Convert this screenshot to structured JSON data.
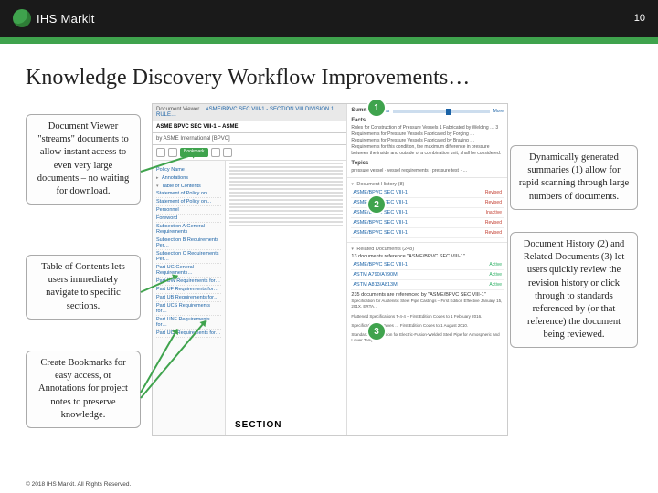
{
  "header": {
    "brand": "IHS Markit",
    "page_number": "10"
  },
  "title": "Knowledge Discovery Workflow Improvements…",
  "callouts": {
    "left1": "Document Viewer \"streams\" documents to allow instant access to even very large documents – no waiting for download.",
    "left2": "Table of Contents lets users immediately navigate to specific sections.",
    "left3": "Create Bookmarks for easy access, or Annotations for project notes to preserve knowledge.",
    "right1": "Dynamically generated summaries (1) allow for rapid scanning through large numbers of documents.",
    "right2": "Document History (2) and Related Documents (3) let users quickly review the revision history or click through to standards referenced by (or that reference) the document being reviewed."
  },
  "badges": {
    "b1": "1",
    "b2": "2",
    "b3": "3"
  },
  "screenshot": {
    "doc_header_primary": "Document Viewer",
    "doc_header_title": "ASME/BPVC SEC VIII-1 - SECTION VIII DIVISION 1 RULE…",
    "doc_subhead": "ASME BPVC SEC VIII-1 – ASME",
    "publisher_line": "by ASME International [BPVC]",
    "bookmark_btn": "Bookmark",
    "toc_items": [
      "Policy Name",
      "Annotations",
      "Table of Contents",
      "Statement of Policy on…",
      "Statement of Policy on…",
      "Personnel",
      "Foreword",
      "Subsection A General Requirements",
      "Subsection B Requirements Per…",
      "Subsection C Requirements Per…",
      "Part UG General Requirements…",
      "Part UW Requirements for…",
      "Part UF Requirements for…",
      "Part UB Requirements for…",
      "Part UCS Requirements for…",
      "Part UNF Requirements for…",
      "Part UCI Requirements for…"
    ],
    "section_label": "SECTION",
    "summary": {
      "tab": "Summary",
      "less": "Less",
      "more": "More",
      "facts_label": "Facts",
      "facts_text": "Rules for Construction of Pressure Vessels 1 Fabricated by Welding … 3 Requirements for Pressure Vessels Fabricated by Forging … Requirements for Pressure Vessels Fabricated by Brazing … Requirements for this condition, the maximum difference in pressure between the inside and outside of a combination unit, shall be considered.",
      "topics_label": "Topics",
      "topics_text": "pressure vessel · vessel requirements · pressure test · …"
    },
    "history": {
      "header": "Document History (8)",
      "rows": [
        {
          "code": "ASME/BPVC SEC VIII-1",
          "status": "Revised",
          "color": "red"
        },
        {
          "code": "ASME/BPVC SEC VIII-1",
          "status": "Revised",
          "color": "red"
        },
        {
          "code": "ASME/BPVC SEC VIII-1",
          "status": "Inactive",
          "color": "red"
        },
        {
          "code": "ASME/BPVC SEC VIII-1",
          "status": "Revised",
          "color": "red"
        },
        {
          "code": "ASME/BPVC SEC VIII-1",
          "status": "Revised",
          "color": "red"
        }
      ]
    },
    "related": {
      "header": "Related Documents (248)",
      "subhead1": "13 documents reference \"ASME/BPVC SEC VIII-1\"",
      "rows1": [
        {
          "code": "ASME/BPVC SEC VIII-1",
          "status": "Active",
          "color": "green"
        },
        {
          "code": "ASTM A790/A790M",
          "status": "Active",
          "color": "green"
        },
        {
          "code": "ASTM A813/A813M",
          "status": "Active",
          "color": "green"
        }
      ],
      "subhead2": "235 documents are referenced by \"ASME/BPVC SEC VIII-1\"",
      "notes": [
        "Specification for Austenitic Steel Pipe Castings – First Edition Effective January 15, 201X. ERTA…",
        "Flattened Specifications T-4-4 – First Edition Codes to 1 February 2016.",
        "Specification for Valves … First Edition Codes to 1 August 2010.",
        "Standard Specification for Electric-Fusion-Welded Steel Pipe for Atmospheric and Lower Temper…"
      ]
    }
  },
  "footer": "© 2018 IHS Markit. All Rights Reserved."
}
